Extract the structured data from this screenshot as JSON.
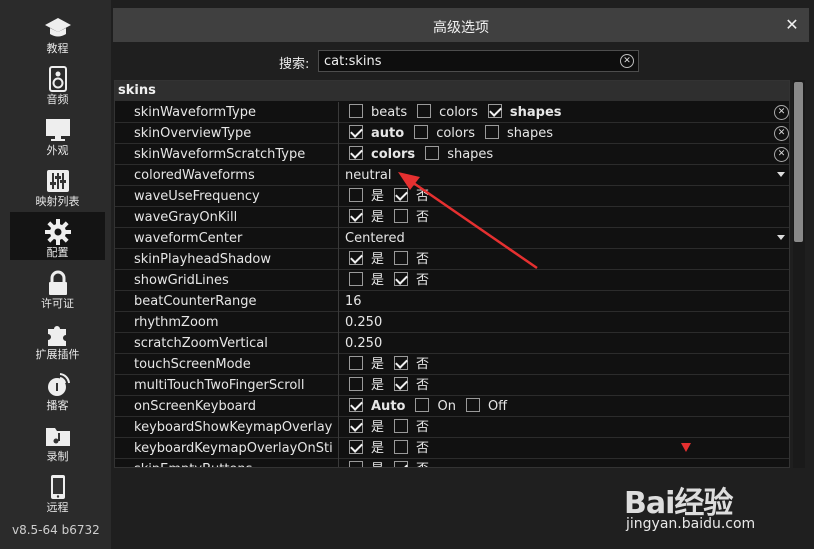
{
  "sidebar": {
    "items": [
      {
        "label": "教程",
        "icon": "graduation-cap-icon"
      },
      {
        "label": "音频",
        "icon": "speaker-icon"
      },
      {
        "label": "外观",
        "icon": "monitor-icon"
      },
      {
        "label": "映射列表",
        "icon": "mixer-sliders-icon"
      },
      {
        "label": "配置",
        "icon": "gear-icon"
      },
      {
        "label": "许可证",
        "icon": "lock-icon"
      },
      {
        "label": "扩展插件",
        "icon": "puzzle-icon"
      },
      {
        "label": "播客",
        "icon": "podcast-icon"
      },
      {
        "label": "录制",
        "icon": "music-folder-icon"
      },
      {
        "label": "远程",
        "icon": "phone-icon"
      }
    ],
    "active_index": 4,
    "version": "v8.5-64 b6732"
  },
  "dialog": {
    "title": "高级选项",
    "close_glyph": "✕",
    "search_label": "搜索:",
    "search_value": "cat:skins"
  },
  "table": {
    "section": "skins",
    "rows": [
      {
        "key": "skinWaveformType",
        "options": [
          {
            "label": "beats",
            "checked": false,
            "bold": false
          },
          {
            "label": "colors",
            "checked": false,
            "bold": false
          },
          {
            "label": "shapes",
            "checked": true,
            "bold": true
          }
        ],
        "clear": true
      },
      {
        "key": "skinOverviewType",
        "options": [
          {
            "label": "auto",
            "checked": true,
            "bold": true
          },
          {
            "label": "colors",
            "checked": false,
            "bold": false
          },
          {
            "label": "shapes",
            "checked": false,
            "bold": false
          }
        ],
        "clear": true
      },
      {
        "key": "skinWaveformScratchType",
        "options": [
          {
            "label": "colors",
            "checked": true,
            "bold": true
          },
          {
            "label": "shapes",
            "checked": false,
            "bold": false
          }
        ],
        "clear": true
      },
      {
        "key": "coloredWaveforms",
        "text": "neutral",
        "dropdown": true
      },
      {
        "key": "waveUseFrequency",
        "options": [
          {
            "label": "是",
            "checked": false
          },
          {
            "label": "否",
            "checked": true
          }
        ]
      },
      {
        "key": "waveGrayOnKill",
        "options": [
          {
            "label": "是",
            "checked": true
          },
          {
            "label": "否",
            "checked": false
          }
        ]
      },
      {
        "key": "waveformCenter",
        "text": "Centered",
        "dropdown": true
      },
      {
        "key": "skinPlayheadShadow",
        "options": [
          {
            "label": "是",
            "checked": true
          },
          {
            "label": "否",
            "checked": false
          }
        ]
      },
      {
        "key": "showGridLines",
        "options": [
          {
            "label": "是",
            "checked": false
          },
          {
            "label": "否",
            "checked": true
          }
        ]
      },
      {
        "key": "beatCounterRange",
        "text": "16"
      },
      {
        "key": "rhythmZoom",
        "text": "0.250"
      },
      {
        "key": "scratchZoomVertical",
        "text": "0.250"
      },
      {
        "key": "touchScreenMode",
        "options": [
          {
            "label": "是",
            "checked": false
          },
          {
            "label": "否",
            "checked": true
          }
        ]
      },
      {
        "key": "multiTouchTwoFingerScroll",
        "options": [
          {
            "label": "是",
            "checked": false
          },
          {
            "label": "否",
            "checked": true
          }
        ]
      },
      {
        "key": "onScreenKeyboard",
        "options": [
          {
            "label": "Auto",
            "checked": true,
            "bold": true
          },
          {
            "label": "On",
            "checked": false
          },
          {
            "label": "Off",
            "checked": false
          }
        ]
      },
      {
        "key": "keyboardShowKeymapOverlay",
        "options": [
          {
            "label": "是",
            "checked": true
          },
          {
            "label": "否",
            "checked": false
          }
        ]
      },
      {
        "key": "keyboardKeymapOverlayOnSti",
        "options": [
          {
            "label": "是",
            "checked": true
          },
          {
            "label": "否",
            "checked": false
          }
        ]
      },
      {
        "key": "skinEmptyButtons",
        "options": [
          {
            "label": "是",
            "checked": false
          },
          {
            "label": "否",
            "checked": true
          }
        ]
      }
    ]
  },
  "colors": {
    "annotation_arrow": "#e53030",
    "panel_bg": "#111111",
    "sidebar_bg": "#2b2b2b"
  },
  "watermark": {
    "brand": "Bai经验",
    "url": "jingyan.baidu.com"
  }
}
